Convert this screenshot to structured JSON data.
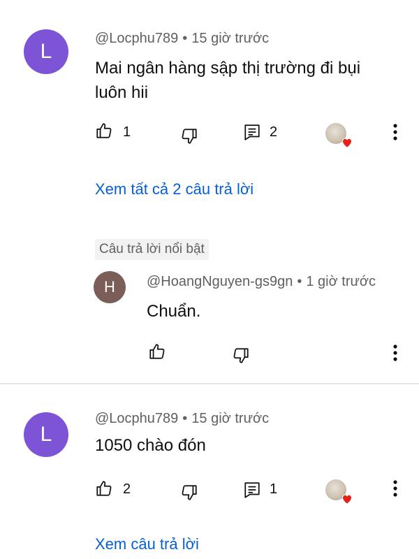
{
  "comments": [
    {
      "avatar_letter": "L",
      "author": "@Locphu789",
      "time": "15 giờ trước",
      "text": "Mai ngân hàng sập thị trường đi bụi luôn hii",
      "likes": "1",
      "replies": "2",
      "view_replies": "Xem tất cả 2 câu trả lời"
    },
    {
      "avatar_letter": "L",
      "author": "@Locphu789",
      "time": "15 giờ trước",
      "text": "1050 chào đón",
      "likes": "2",
      "replies": "1",
      "view_replies": "Xem câu trả lời"
    }
  ],
  "highlighted_reply": {
    "label": "Câu trả lời nổi bật",
    "avatar_letter": "H",
    "author": "@HoangNguyen-gs9gn",
    "time": "1 giờ trước",
    "text": "Chuẩn."
  },
  "separator": "•",
  "icons": {
    "like": "thumbs-up-icon",
    "dislike": "thumbs-down-icon",
    "reply": "reply-icon",
    "more": "more-vertical-icon",
    "heart": "heart-icon"
  },
  "colors": {
    "accent_link": "#065fd4",
    "avatar_l": "#7d54d6",
    "avatar_h": "#7b5e57",
    "heart": "#e62117"
  }
}
